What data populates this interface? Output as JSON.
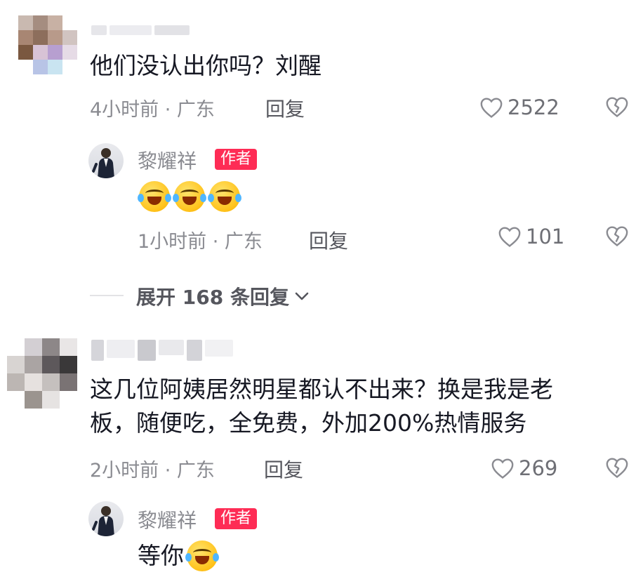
{
  "comments": [
    {
      "text": "他们没认出你吗？刘醒",
      "time_location": "4小时前 · 广东",
      "reply_label": "回复",
      "likes": "2522",
      "reply": {
        "author": "黎耀祥",
        "badge": "作者",
        "emoji_count": 3,
        "time_location": "1小时前 · 广东",
        "reply_label": "回复",
        "likes": "101"
      },
      "expand_label": "展开 168 条回复"
    },
    {
      "text_lines": [
        "这几位阿姨居然明星都认不出来？换是我是老",
        "板，随便吃，全免费，外加200%热情服务"
      ],
      "time_location": "2小时前 · 广东",
      "reply_label": "回复",
      "likes": "269",
      "reply": {
        "author": "黎耀祥",
        "badge": "作者",
        "text": "等你",
        "emoji_count": 1
      }
    }
  ],
  "colors": {
    "accent": "#fe2c55",
    "text": "#161823",
    "muted": "#8a8b91"
  },
  "icons": [
    "heart-icon",
    "dislike-heart-icon",
    "chevron-down-icon",
    "laugh-cry-emoji"
  ]
}
